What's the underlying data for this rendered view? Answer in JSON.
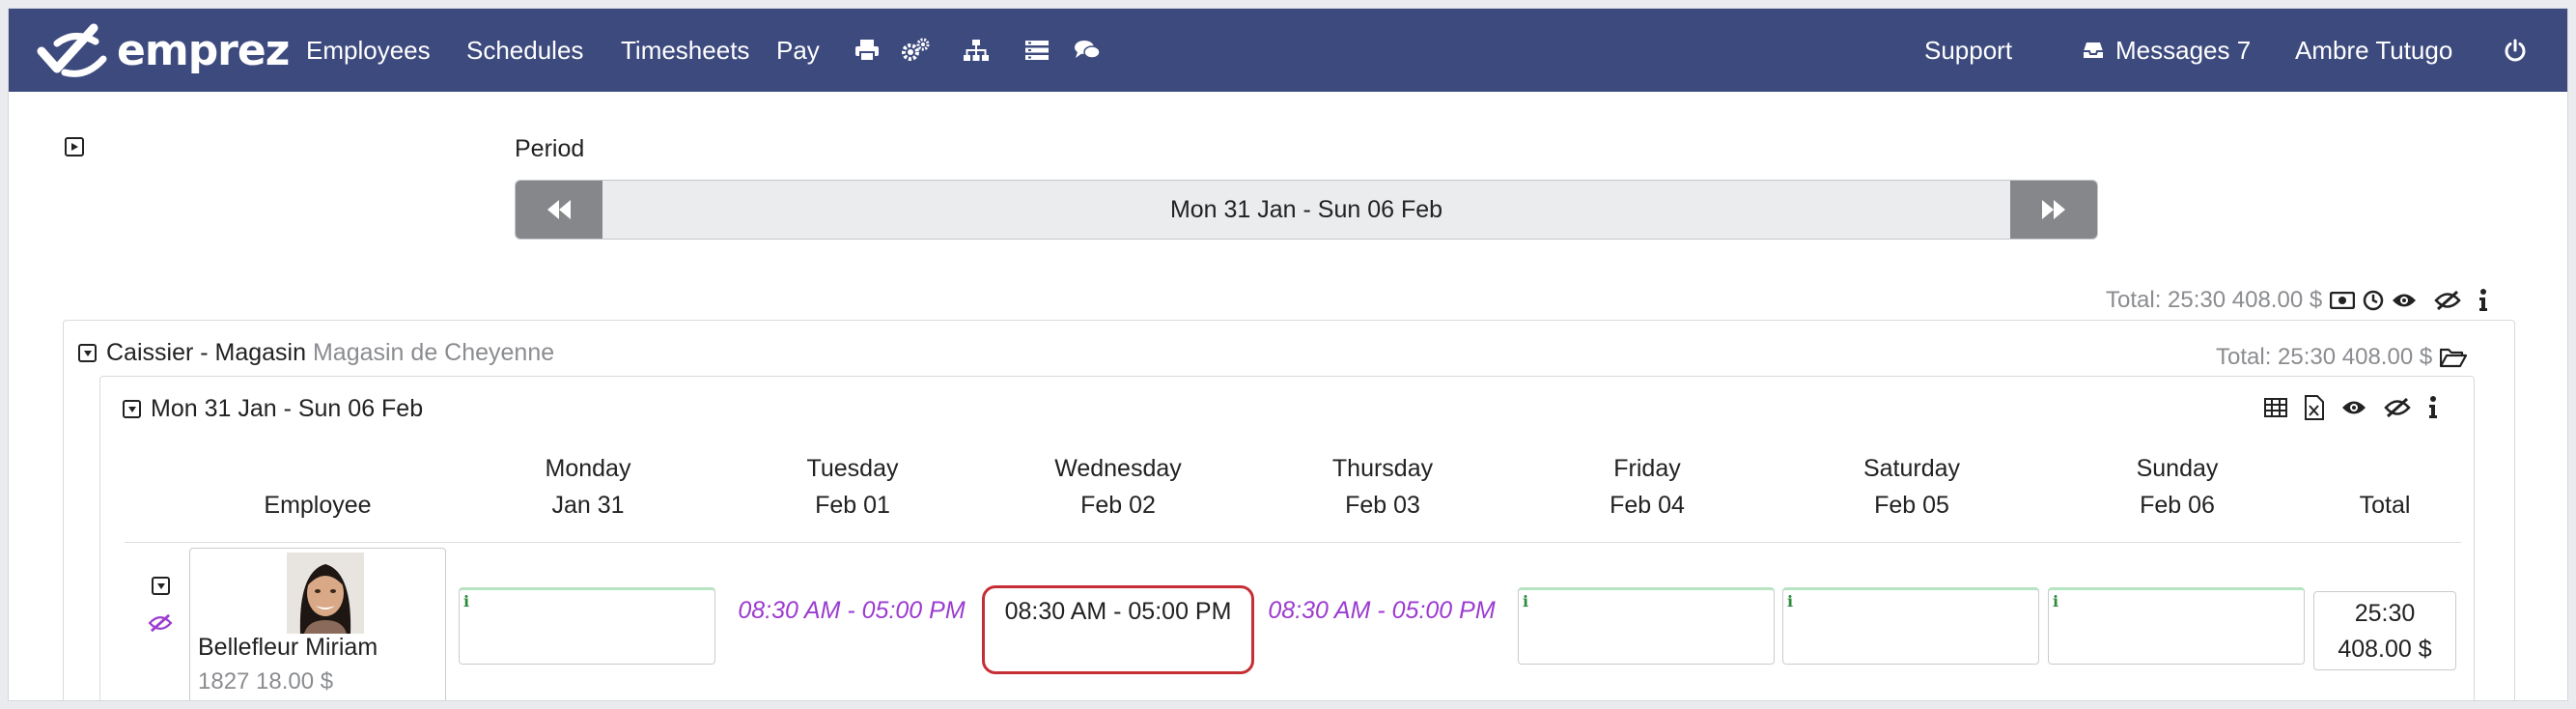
{
  "nav": {
    "brand": "emprez",
    "links": [
      "Employees",
      "Schedules",
      "Timesheets",
      "Pay"
    ],
    "icons": [
      "printer-icon",
      "cogs-icon",
      "org-chart-icon",
      "list-icon",
      "comments-icon"
    ],
    "support": "Support",
    "messages": "Messages 7",
    "user": "Ambre Tutugo"
  },
  "period": {
    "label": "Period",
    "range": "Mon 31 Jan - Sun 06 Feb"
  },
  "summary": {
    "total": "Total: 25:30 408.00 $"
  },
  "group": {
    "position": "Caissier - Magasin",
    "location": "Magasin de Cheyenne",
    "total": "Total: 25:30 408.00 $"
  },
  "week": {
    "title": "Mon 31 Jan - Sun 06 Feb"
  },
  "table": {
    "employee_header": "Employee",
    "total_header": "Total",
    "days": [
      {
        "day": "Monday",
        "date": "Jan 31"
      },
      {
        "day": "Tuesday",
        "date": "Feb 01"
      },
      {
        "day": "Wednesday",
        "date": "Feb 02"
      },
      {
        "day": "Thursday",
        "date": "Feb 03"
      },
      {
        "day": "Friday",
        "date": "Feb 04"
      },
      {
        "day": "Saturday",
        "date": "Feb 05"
      },
      {
        "day": "Sunday",
        "date": "Feb 06"
      }
    ]
  },
  "employee": {
    "name": "Bellefleur Miriam",
    "meta": "1827 18.00 $",
    "shifts": {
      "tuesday": "08:30 AM - 05:00 PM",
      "wednesday": "08:30 AM - 05:00 PM",
      "thursday": "08:30 AM - 05:00 PM"
    },
    "total_hours": "25:30",
    "total_pay": "408.00 $"
  },
  "colors": {
    "navbar": "#3d4a7e",
    "shift_text": "#9b3bd0",
    "selected_border": "#c62e35",
    "info_green": "#2e8b3e"
  }
}
